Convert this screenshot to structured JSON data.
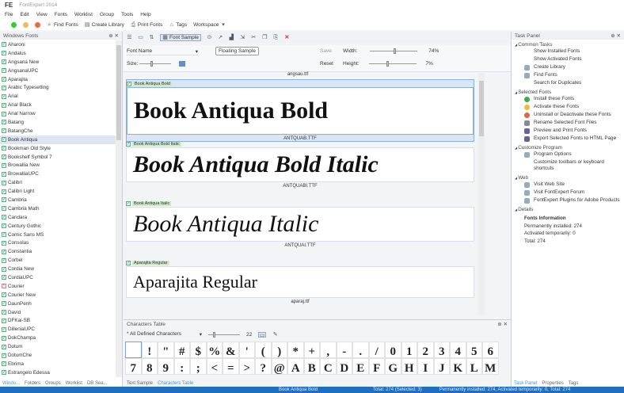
{
  "app": {
    "title": "FontExpert 2014",
    "logo": "FE"
  },
  "menu": [
    "File",
    "Edit",
    "View",
    "Fonts",
    "Worklist",
    "Group",
    "Tools",
    "Help"
  ],
  "toolbar": {
    "find": "Find Fonts",
    "library": "Create Library",
    "print": "Print Fonts",
    "tags": "Tags",
    "workspace": "Workspace"
  },
  "left": {
    "title": "Windows Fonts",
    "fonts": [
      "Aharoni",
      "Andalus",
      "Angsana New",
      "AngsanaUPC",
      "Aparajita",
      "Arabic Typesetting",
      "Arial",
      "Arial Black",
      "Arial Narrow",
      "Batang",
      "BatangChe",
      "Book Antiqua",
      "Bookman Old Style",
      "Bookshelf Symbol 7",
      "Browallia New",
      "BrowalliaUPC",
      "Calibri",
      "Calibri Light",
      "Cambria",
      "Cambria Math",
      "Candara",
      "Century Gothic",
      "Comic Sans MS",
      "Consolas",
      "Constantia",
      "Corbel",
      "Cordia New",
      "CordiaUPC",
      "Courier",
      "Courier New",
      "DaunPenh",
      "David",
      "DFKai-SB",
      "DilleniaUPC",
      "DokChampa",
      "Dotum",
      "DotumChe",
      "Ebrima",
      "Estrangelo Edessa"
    ],
    "selected": "Book Antiqua",
    "warn": "Courier",
    "tabs": [
      "Windo...",
      "Folders",
      "Groups",
      "Worklist",
      "DB Sea..."
    ]
  },
  "center": {
    "font_sample_btn": "Font Sample",
    "tooltip": "Floating Sample",
    "font_name": "Font Name",
    "size_label": "Size:",
    "save": "Save",
    "reset": "Reset",
    "width_label": "Width:",
    "width_val": "74%",
    "height_label": "Height:",
    "height_val": "7%",
    "prev_file": "angsau.ttf",
    "samples": [
      {
        "label": "Book Antiqua Bold",
        "text": "Book Antiqua Bold",
        "file": "ANTQUAB.TTF",
        "bold": true,
        "italic": false
      },
      {
        "label": "Book Antiqua Bold Italic",
        "text": "Book Antiqua Bold Italic",
        "file": "ANTQUABI.TTF",
        "bold": true,
        "italic": true
      },
      {
        "label": "Book Antiqua Italic",
        "text": "Book Antiqua Italic",
        "file": "ANTQUAI.TTF",
        "bold": false,
        "italic": true
      },
      {
        "label": "Aparajita Regular",
        "text": "Aparajita Regular",
        "file": "aparaj.ttf",
        "bold": false,
        "italic": false
      }
    ]
  },
  "chartable": {
    "title": "Characters Table",
    "filter": "* All Defined Characters",
    "size": "22",
    "chars": [
      " ",
      "!",
      "\"",
      "#",
      "$",
      "%",
      "&",
      "'",
      "(",
      ")",
      "*",
      "+",
      ",",
      "-",
      ".",
      "/",
      "0",
      "1",
      "2",
      "3",
      "4",
      "5",
      "6",
      "7",
      "8",
      "9",
      ":",
      ";",
      "<",
      "=",
      ">",
      "?",
      "@",
      "A",
      "B",
      "C",
      "D",
      "E",
      "F",
      "G",
      "H",
      "I",
      "J",
      "K",
      "L",
      "M"
    ]
  },
  "center_tabs": [
    "Text Sample",
    "Characters Table"
  ],
  "right": {
    "title": "Task Panel",
    "sections": [
      {
        "name": "Common Tasks",
        "items": [
          "Show Installed Fonts",
          "Show Activated Fonts",
          "Create Library",
          "Find Fonts",
          "Search for Duplicates"
        ]
      },
      {
        "name": "Selected Fonts",
        "items": [
          "Install these Fonts",
          "Activate these Fonts",
          "Uninstall or Deactivate these Fonts",
          "Rename Selected Font Files",
          "Preview and Print Fonts",
          "Export Selected Fonts to HTML Page"
        ]
      },
      {
        "name": "Customize Program",
        "items": [
          "Program Options",
          "Customize toolbars or keyboard shortcuts"
        ]
      },
      {
        "name": "Web",
        "items": [
          "Visit Web Site",
          "Visit FontExpert Forum",
          "FontExpert Plugins for Adobe Products"
        ]
      }
    ],
    "details": {
      "name": "Details",
      "heading": "Fonts Information",
      "lines": [
        "Permanently installed: 274",
        "Activated temporarily: 0",
        "Total: 274"
      ]
    },
    "tabs": [
      "Task Panel",
      "Properties",
      "Tags"
    ]
  },
  "status": {
    "font": "Book Antiqua Bold",
    "total": "Total: 274 (Selected: 3)",
    "info": "Permanently installed: 274, Activated temporarily: 0, Total: 274"
  }
}
